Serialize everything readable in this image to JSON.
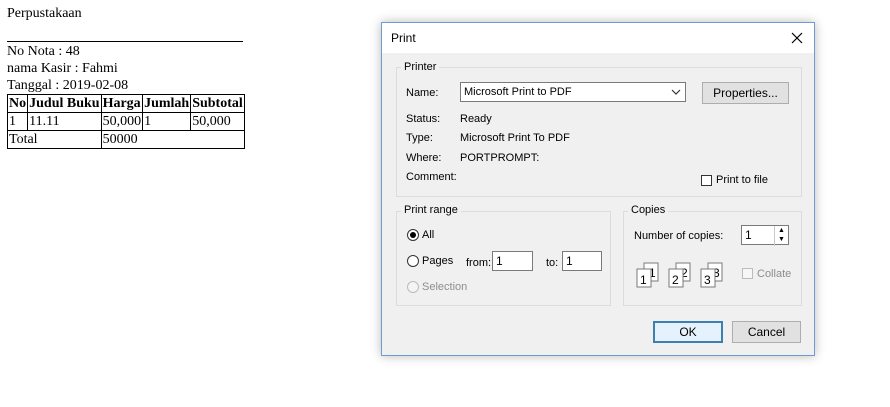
{
  "receipt": {
    "shop_name": "Perpustakaan",
    "nota": "No Nota : 48",
    "kasir": "nama Kasir : Fahmi",
    "tanggal": "Tanggal : 2019-02-08",
    "headers": [
      "No",
      "Judul Buku",
      "Harga",
      "Jumlah",
      "Subtotal"
    ],
    "rows": [
      [
        "1",
        "11.11",
        "50,000",
        "1",
        "50,000"
      ]
    ],
    "total_label": "Total",
    "total_value": "50000"
  },
  "dialog": {
    "title": "Print",
    "close_icon": "close-icon",
    "printer": {
      "legend": "Printer",
      "name_label": "Name:",
      "name_value": "Microsoft Print to PDF",
      "properties_label": "Properties...",
      "status_label": "Status:",
      "status_value": "Ready",
      "type_label": "Type:",
      "type_value": "Microsoft Print To PDF",
      "where_label": "Where:",
      "where_value": "PORTPROMPT:",
      "comment_label": "Comment:",
      "print_to_file_label": "Print to file"
    },
    "range": {
      "legend": "Print range",
      "all_label": "All",
      "pages_label": "Pages",
      "from_label": "from:",
      "from_value": "1",
      "to_label": "to:",
      "to_value": "1",
      "selection_label": "Selection",
      "selected": "All"
    },
    "copies": {
      "legend": "Copies",
      "number_label": "Number of copies:",
      "number_value": "1",
      "collate_label": "Collate",
      "collate_icon": "collate-pages-icon"
    },
    "ok_label": "OK",
    "cancel_label": "Cancel"
  }
}
